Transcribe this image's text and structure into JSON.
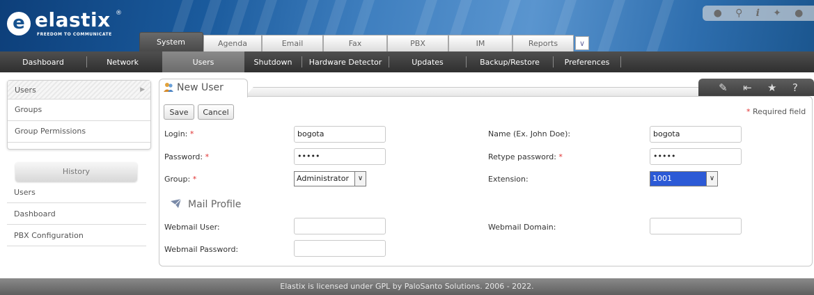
{
  "logo": {
    "name": "elastix",
    "tagline": "FREEDOM TO COMMUNICATE",
    "reg": "®"
  },
  "toolbar_icons": [
    "drop-icon",
    "search-icon",
    "info-icon",
    "puzzle-icon",
    "user-icon"
  ],
  "main_tabs": [
    {
      "label": "System"
    },
    {
      "label": "Agenda"
    },
    {
      "label": "Email"
    },
    {
      "label": "Fax"
    },
    {
      "label": "PBX"
    },
    {
      "label": "IM"
    },
    {
      "label": "Reports"
    }
  ],
  "sub_nav": [
    {
      "label": "Dashboard"
    },
    {
      "label": "Network"
    },
    {
      "label": "Users"
    },
    {
      "label": "Shutdown"
    },
    {
      "label": "Hardware Detector"
    },
    {
      "label": "Updates"
    },
    {
      "label": "Backup/Restore"
    },
    {
      "label": "Preferences"
    }
  ],
  "sidebar": {
    "menu": [
      {
        "label": "Users"
      },
      {
        "label": "Groups"
      },
      {
        "label": "Group Permissions"
      }
    ],
    "history_title": "History",
    "history": [
      {
        "label": "Users"
      },
      {
        "label": "Dashboard"
      },
      {
        "label": "PBX Configuration"
      }
    ]
  },
  "panel": {
    "title": "New User",
    "save_label": "Save",
    "cancel_label": "Cancel",
    "required_note": "Required field",
    "required_mark": "*"
  },
  "form": {
    "login_label": "Login:",
    "login_value": "bogota",
    "name_label": "Name (Ex. John Doe):",
    "name_value": "bogota",
    "password_label": "Password:",
    "password_value": "•••••",
    "retype_label": "Retype password:",
    "retype_value": "•••••",
    "group_label": "Group:",
    "group_value": "Administrator",
    "extension_label": "Extension:",
    "extension_value": "1001",
    "mail_profile_title": "Mail Profile",
    "webmail_user_label": "Webmail User:",
    "webmail_user_value": "",
    "webmail_domain_label": "Webmail Domain:",
    "webmail_domain_value": "",
    "webmail_password_label": "Webmail Password:",
    "webmail_password_value": ""
  },
  "footer": {
    "text": "Elastix is licensed under GPL by PaloSanto Solutions. 2006 - 2022."
  },
  "colors": {
    "accent_blue": "#1a5a9c",
    "nav_dark": "#3f3f3f",
    "required_red": "#e03030",
    "selected_blue": "#2c5ad6"
  }
}
